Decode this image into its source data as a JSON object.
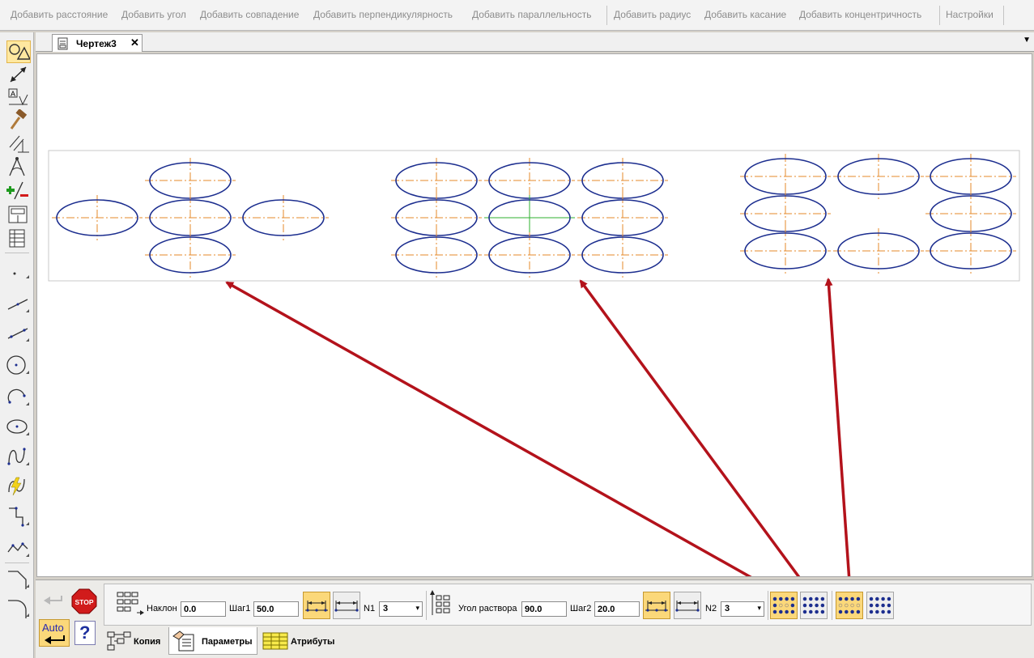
{
  "top_toolbar": {
    "buttons": [
      "Добавить расстояние",
      "Добавить угол",
      "Добавить совпадение",
      "Добавить перпендикулярность",
      "Добавить параллельность",
      "Добавить радиус",
      "Добавить касание",
      "Добавить концентричность",
      "Настройки"
    ]
  },
  "document": {
    "tab_label": "Чертеж3",
    "close_glyph": "✕",
    "menu_glyph": "▼"
  },
  "left_toolbar": {
    "tools": [
      "geometry-icon",
      "dimensions-icon",
      "annotation-icon",
      "edit-hammer-icon",
      "parametrization-icon",
      "measure-icon",
      "select-icon",
      "view-icon",
      "spec-icon",
      "point-icon",
      "segment-icon",
      "auxiliary-line-icon",
      "circle-icon",
      "arc-icon",
      "ellipse-icon",
      "spline-icon",
      "hatch-icon",
      "contour-icon",
      "polyline-icon",
      "chamfer-icon",
      "fillet-icon"
    ]
  },
  "drawing": {
    "colors": {
      "ellipse": "#1c2e8f",
      "axis": "#e48a2a",
      "selected_axis": "#2fb02f",
      "arrow": "#b3121b",
      "frame": "#c8c8c8"
    }
  },
  "params": {
    "tilt_label": "Наклон",
    "tilt_value": "0.0",
    "step1_label": "Шаг1",
    "step1_value": "50.0",
    "n1_label": "N1",
    "n1_value": "3",
    "opening_angle_label": "Угол раствора",
    "opening_angle_value": "90.0",
    "step2_label": "Шаг2",
    "step2_value": "20.0",
    "n2_label": "N2",
    "n2_value": "3",
    "dropdown_glyph": "▾"
  },
  "panel_controls": {
    "stop_label": "STOP",
    "auto_label": "Auto",
    "help_label": "?"
  },
  "bottom_tabs": {
    "copy_label": "Копия",
    "params_label": "Параметры",
    "attributes_label": "Атрибуты"
  }
}
